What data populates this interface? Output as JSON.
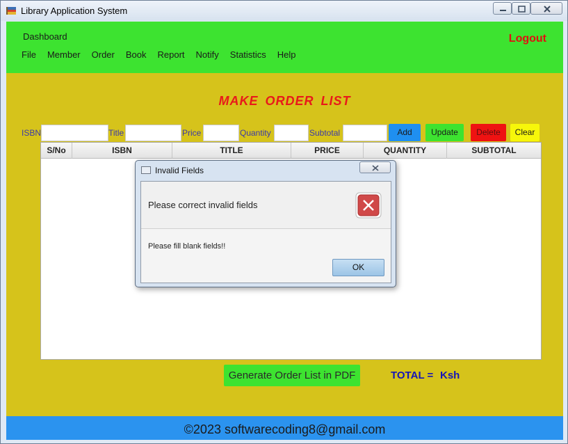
{
  "window": {
    "title": "Library Application System",
    "icon": "books-icon"
  },
  "header": {
    "dashboard": "Dashboard",
    "menu": [
      "File",
      "Member",
      "Order",
      "Book",
      "Report",
      "Notify",
      "Statistics",
      "Help"
    ],
    "logout": "Logout"
  },
  "page": {
    "title": "MAKE  ORDER  LIST"
  },
  "form": {
    "isbn_label": "ISBN",
    "title_label": "Title",
    "price_label": "Price",
    "quantity_label": "Quantity",
    "subtotal_label": "Subtotal",
    "isbn_value": "",
    "title_value": "",
    "price_value": "",
    "quantity_value": "",
    "subtotal_value": ""
  },
  "actions": {
    "add": "Add",
    "update": "Update",
    "delete": "Delete",
    "clear": "Clear"
  },
  "table": {
    "columns": [
      "S/No",
      "ISBN",
      "TITLE",
      "PRICE",
      "QUANTITY",
      "SUBTOTAL"
    ],
    "rows": []
  },
  "bottom": {
    "generate_pdf": "Generate Order List in PDF",
    "total_label": "TOTAL  =",
    "total_value": "Ksh"
  },
  "footer": {
    "text": "©2023 softwarecoding8@gmail.com"
  },
  "dialog": {
    "title": "Invalid Fields",
    "heading": "Please correct invalid fields",
    "message": "Please fill blank fields!!",
    "ok": "OK",
    "icon": "error-icon"
  },
  "colors": {
    "header_green": "#3de330",
    "content_yellow": "#d6c31b",
    "footer_blue": "#2b93ef",
    "title_red": "#e81a1a",
    "add_blue": "#1f8ff0",
    "update_green": "#3de330",
    "delete_red": "#ef1212",
    "clear_yellow": "#f7f70a"
  }
}
